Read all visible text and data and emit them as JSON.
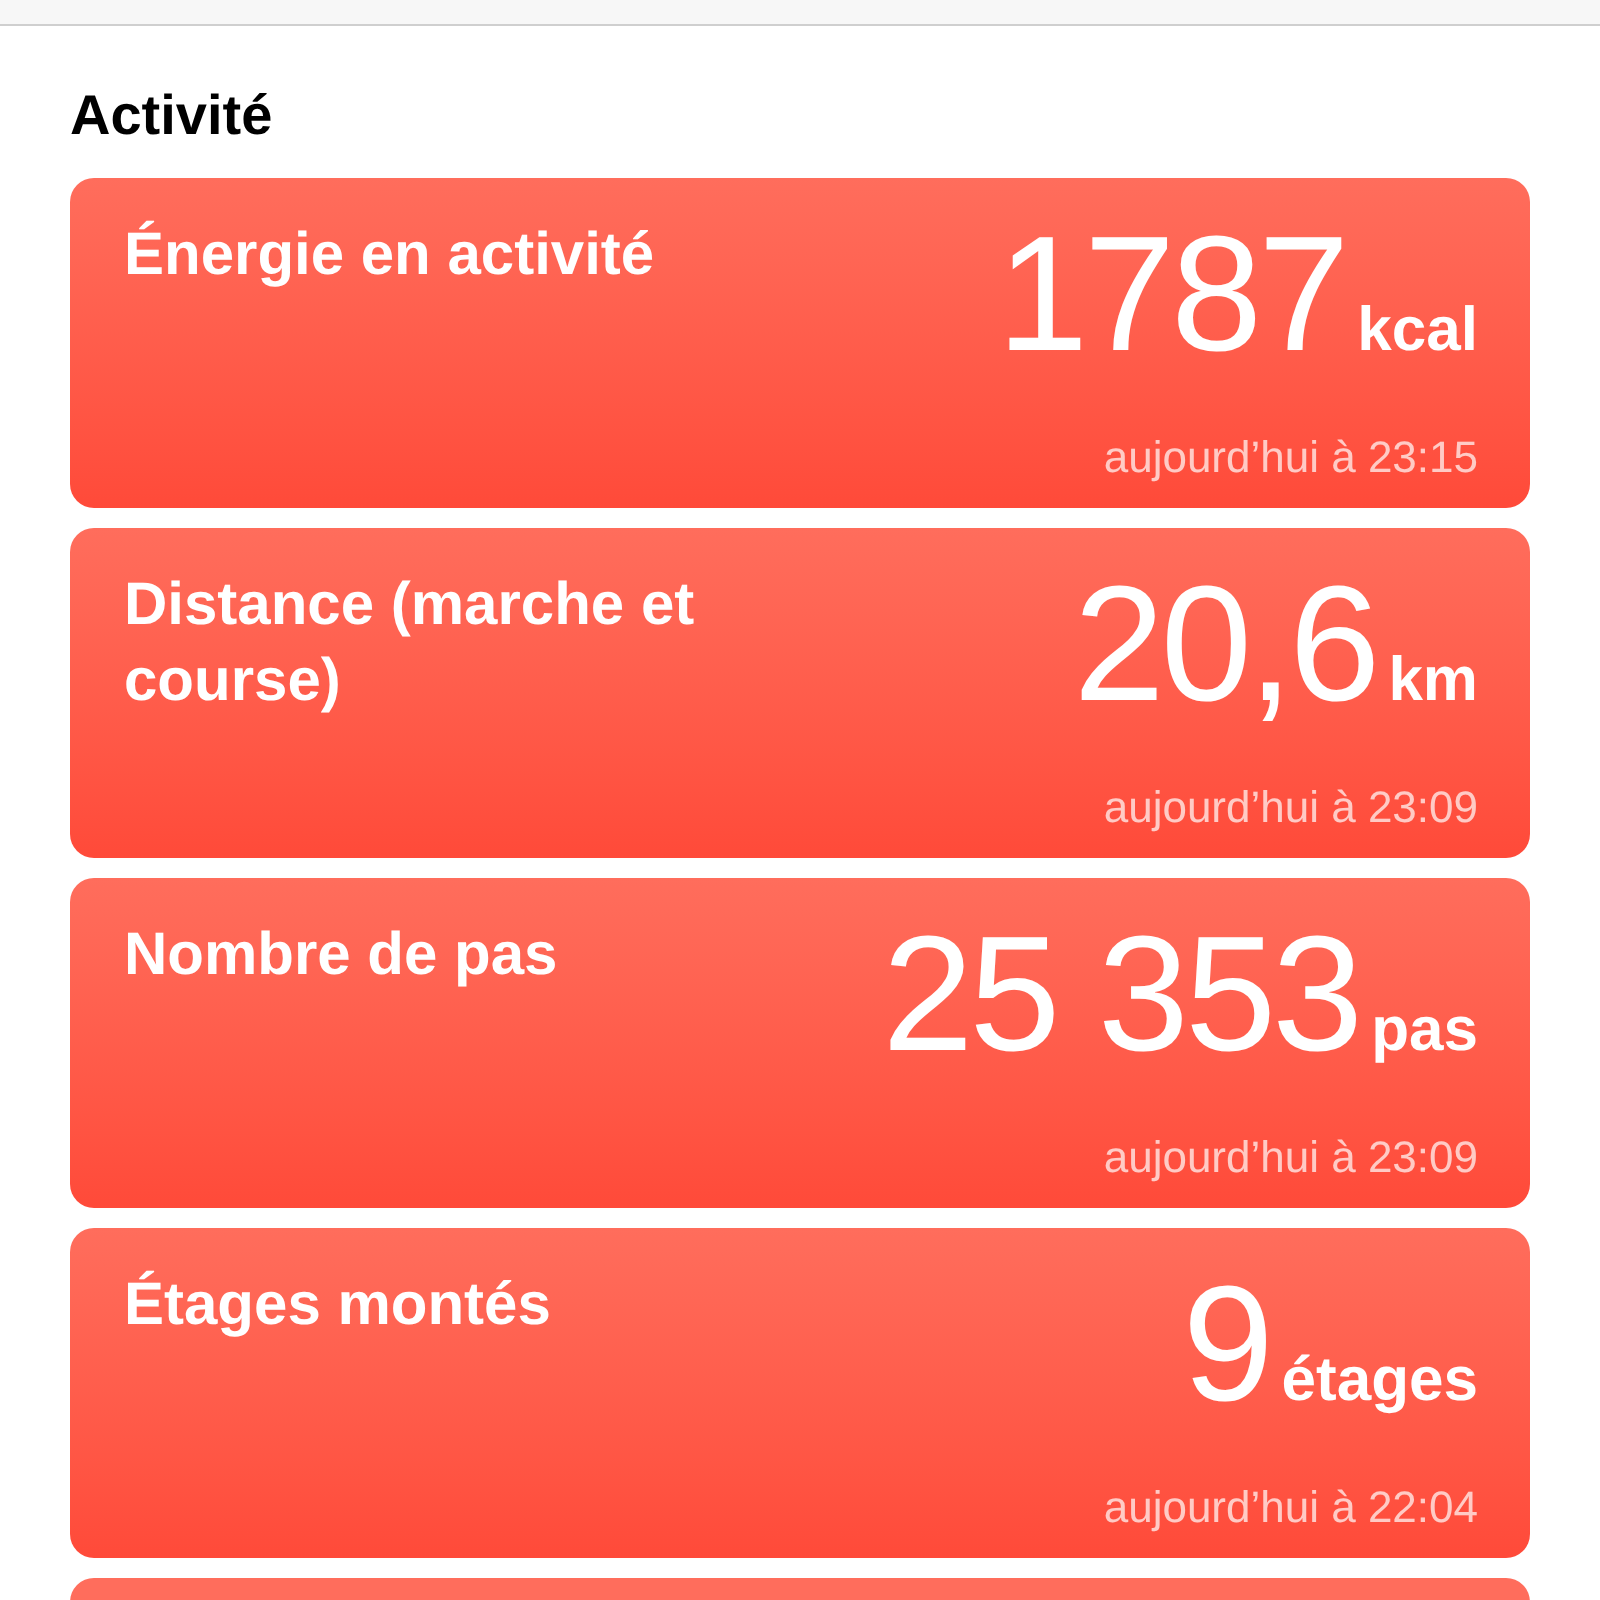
{
  "section_title": "Activité",
  "cards": [
    {
      "title": "Énergie en activité",
      "value": "1787",
      "unit": "kcal",
      "time": "aujourd’hui à 23:15"
    },
    {
      "title": "Distance (marche et course)",
      "value": "20,6",
      "unit": "km",
      "time": "aujourd’hui à 23:09"
    },
    {
      "title": "Nombre de pas",
      "value": "25 353",
      "unit": "pas",
      "time": "aujourd’hui à 23:09"
    },
    {
      "title": "Étages montés",
      "value": "9",
      "unit": "étages",
      "time": "aujourd’hui à 22:04"
    }
  ]
}
